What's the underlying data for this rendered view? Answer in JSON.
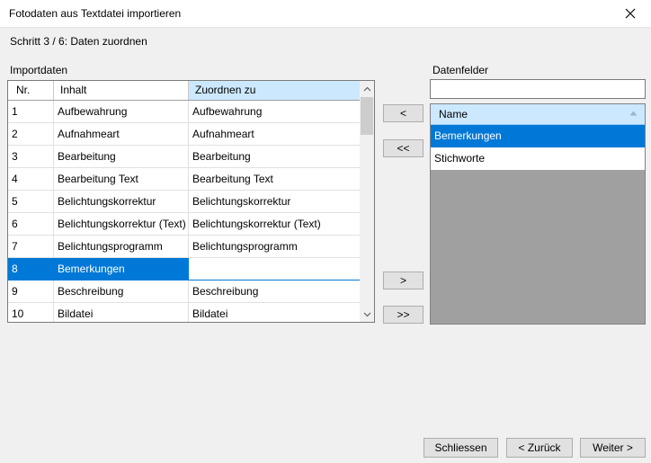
{
  "window": {
    "title": "Fotodaten aus Textdatei importieren"
  },
  "step": "Schritt 3 / 6: Daten zuordnen",
  "import": {
    "label": "Importdaten",
    "columns": [
      "Nr.",
      "Inhalt",
      "Zuordnen zu"
    ],
    "rows": [
      {
        "nr": "1",
        "inhalt": "Aufbewahrung",
        "zuordnen": "Aufbewahrung"
      },
      {
        "nr": "2",
        "inhalt": "Aufnahmeart",
        "zuordnen": "Aufnahmeart"
      },
      {
        "nr": "3",
        "inhalt": "Bearbeitung",
        "zuordnen": "Bearbeitung"
      },
      {
        "nr": "4",
        "inhalt": "Bearbeitung Text",
        "zuordnen": "Bearbeitung Text"
      },
      {
        "nr": "5",
        "inhalt": "Belichtungskorrektur",
        "zuordnen": "Belichtungskorrektur"
      },
      {
        "nr": "6",
        "inhalt": "Belichtungskorrektur (Text)",
        "zuordnen": "Belichtungskorrektur (Text)"
      },
      {
        "nr": "7",
        "inhalt": "Belichtungsprogramm",
        "zuordnen": "Belichtungsprogramm"
      },
      {
        "nr": "8",
        "inhalt": "Bemerkungen",
        "zuordnen": "",
        "selected": true
      },
      {
        "nr": "9",
        "inhalt": "Beschreibung",
        "zuordnen": "Beschreibung"
      },
      {
        "nr": "10",
        "inhalt": "Bildatei",
        "zuordnen": "Bildatei"
      }
    ]
  },
  "transfer": {
    "assign": "<",
    "assign_all": "<<",
    "remove": ">",
    "remove_all": ">>"
  },
  "fields": {
    "label": "Datenfelder",
    "filter_value": "",
    "column": "Name",
    "items": [
      {
        "name": "Bemerkungen",
        "selected": true
      },
      {
        "name": "Stichworte"
      }
    ]
  },
  "footer": {
    "close": "Schliessen",
    "back": "< Zurück",
    "next": "Weiter >"
  },
  "colors": {
    "selection": "#0078d7",
    "header_highlight": "#cce8ff",
    "list_background": "#a0a0a0"
  }
}
